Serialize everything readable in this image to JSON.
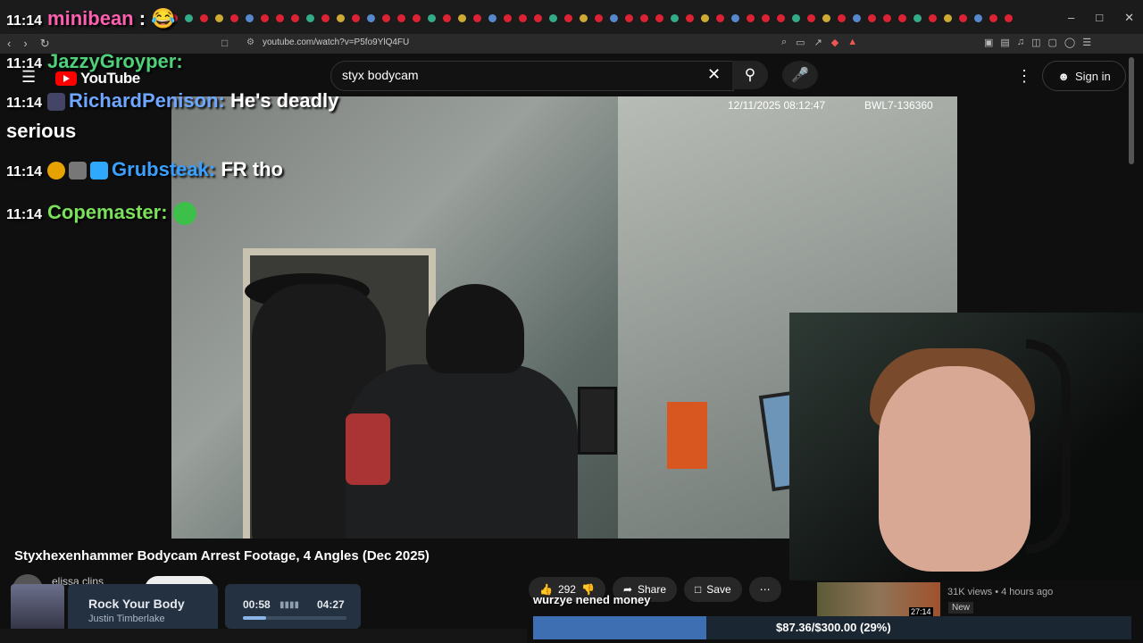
{
  "browser": {
    "url": "youtube.com/watch?v=P5fo9YlQ4FU"
  },
  "youtube": {
    "logo": "YouTube",
    "search_value": "styx bodycam",
    "sign_in": "Sign in"
  },
  "video": {
    "osd_timestamp": "12/11/2025 08:12:47",
    "osd_device": "BWL7-136360",
    "title": "Styxhexenhammer Bodycam Arrest Footage, 4 Angles (Dec 2025)",
    "channel": "elissa clins",
    "likes": "292",
    "share": "Share",
    "save": "Save"
  },
  "recommended": {
    "duration": "27:14",
    "meta": "31K views • 4 hours ago",
    "badge": "New"
  },
  "chat": [
    {
      "time": "11:14",
      "user": "minibean",
      "user_color": "#ff5fb0",
      "message": ""
    },
    {
      "time": "11:14",
      "user": "JazzyGroyper",
      "user_color": "#4fd17a",
      "message": ""
    },
    {
      "time": "11:14",
      "user": "RichardPenison",
      "user_color": "#6ea7ff",
      "message": "He's deadly"
    },
    {
      "time": "",
      "user": "",
      "user_color": "#ffffff",
      "message": "serious"
    },
    {
      "time": "11:14",
      "user": "Grubsteak",
      "user_color": "#3aa0ff",
      "message": "FR tho"
    },
    {
      "time": "11:14",
      "user": "Copemaster",
      "user_color": "#7be05a",
      "message": ""
    }
  ],
  "now_playing": {
    "song": "Rock Your Body",
    "artist": "Justin Timberlake",
    "elapsed": "00:58",
    "total": "04:27",
    "progress": 0.22
  },
  "donation_goal": {
    "label": "wurzye nened money",
    "text": "$87.36/$300.00 (29%)",
    "progress": 0.29
  },
  "colors": {
    "accent_red": "#ff0000",
    "goal_fill": "#3e6fb3"
  }
}
